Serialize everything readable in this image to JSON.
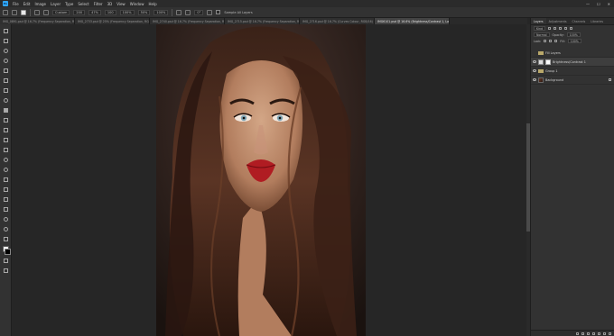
{
  "menu": {
    "logo": "Ps",
    "items": [
      "File",
      "Edit",
      "Image",
      "Layer",
      "Type",
      "Select",
      "Filter",
      "3D",
      "View",
      "Window",
      "Help"
    ],
    "window_controls": [
      "—",
      "☐",
      "✕"
    ]
  },
  "options_bar": {
    "tool_preset": "Custom",
    "fields": [
      "200",
      "47%",
      "100",
      "100%",
      "50%",
      "100%"
    ],
    "angle": "0°",
    "sample_all_layers_label": "Sample All Layers"
  },
  "tabs": [
    {
      "label": "IMG_0891.psd @ 16.7% (Frequency Separation, RGB/16)",
      "active": false
    },
    {
      "label": "IMG_2733.psd @ 25% (Frequency Separation, RGB/16)",
      "active": false
    },
    {
      "label": "IMG_2740.psd @ 16.7% (Frequency Separation, RGB/16)",
      "active": false
    },
    {
      "label": "IMG_2715.psd @ 16.7% (Frequency Separation, RGB/16)",
      "active": false
    },
    {
      "label": "IMG_2716.psd @ 16.7% (Curves Colour, RGB/16)",
      "active": false
    },
    {
      "label": "IMG6101.psd @ 16.6% (Brightness/Contrast 1, Layer Mask/16) *",
      "active": true
    }
  ],
  "panel": {
    "tabs": [
      "Layers",
      "Adjustments",
      "Channels",
      "Libraries"
    ],
    "filter_kind": "Kind",
    "blend_mode": "Normal",
    "opacity_label": "Opacity:",
    "opacity_value": "100%",
    "lock_label": "Lock:",
    "fill_label": "Fill:",
    "fill_value": "100%",
    "layers": [
      {
        "name": "Fill Layers",
        "type": "folder",
        "visible": false
      },
      {
        "name": "Brightness/Contrast 1",
        "type": "adjustment",
        "visible": true,
        "selected": true
      },
      {
        "name": "Group 1",
        "type": "folder",
        "visible": true
      },
      {
        "name": "Background",
        "type": "photo",
        "visible": true,
        "locked": true
      }
    ]
  },
  "colors": {
    "accent": "#31a8ff",
    "lip": "#b01c22",
    "canvas_bg": "#262626"
  },
  "status": {
    "zoom": "16.6%"
  }
}
